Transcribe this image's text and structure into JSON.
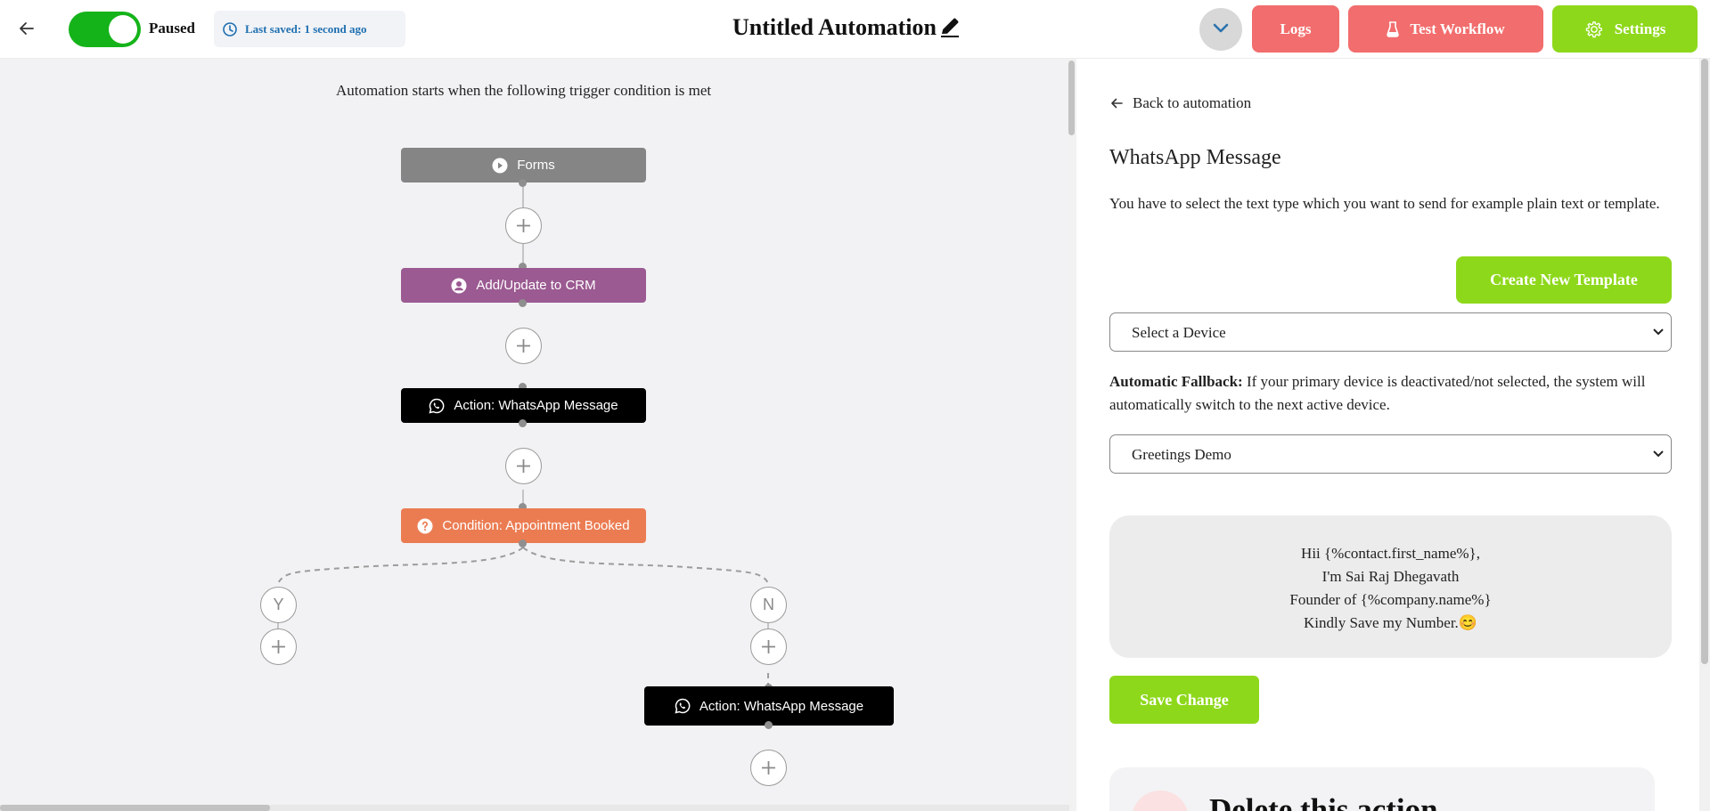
{
  "header": {
    "status_label": "Paused",
    "toggle_on": true,
    "last_saved": "Last saved: 1 second ago",
    "title": "Untitled Automation",
    "logs_label": "Logs",
    "test_label": "Test Workflow",
    "settings_label": "Settings"
  },
  "canvas": {
    "trigger_text": "Automation starts when the following trigger condition is met",
    "nodes": [
      {
        "label": "Forms",
        "icon": "play-circle-icon",
        "color": "#858585"
      },
      {
        "label": "Add/Update to CRM",
        "icon": "user-circle-icon",
        "color": "#9b5a91"
      },
      {
        "label": "Action: WhatsApp Message",
        "icon": "whatsapp-icon",
        "color": "#000000"
      },
      {
        "label": "Condition: Appointment Booked",
        "icon": "question-circle-icon",
        "color": "#eb7c52"
      },
      {
        "label": "Action: WhatsApp Message",
        "icon": "whatsapp-icon",
        "color": "#000000"
      }
    ],
    "branch_yes": "Y",
    "branch_no": "N"
  },
  "panel": {
    "back_label": "Back to automation",
    "title": "WhatsApp Message",
    "description": "You have to select the text type which you want to send for example plain text or template.",
    "create_template_label": "Create New Template",
    "device_select": "Select a Device",
    "fallback_bold": "Automatic Fallback:",
    "fallback_text": " If your primary device is deactivated/not selected, the system will automatically switch to the next active device.",
    "template_select": "Greetings Demo",
    "message_lines": [
      "Hii {%contact.first_name%},",
      "I'm Sai Raj Dhegavath",
      "Founder of {%company.name%}",
      "Kindly Save my Number.😊"
    ],
    "save_label": "Save Change",
    "delete_title": "Delete this action"
  },
  "colors": {
    "accent_green": "#8ed81b",
    "accent_red": "#f26d6d",
    "toggle_green": "#15b31a"
  }
}
